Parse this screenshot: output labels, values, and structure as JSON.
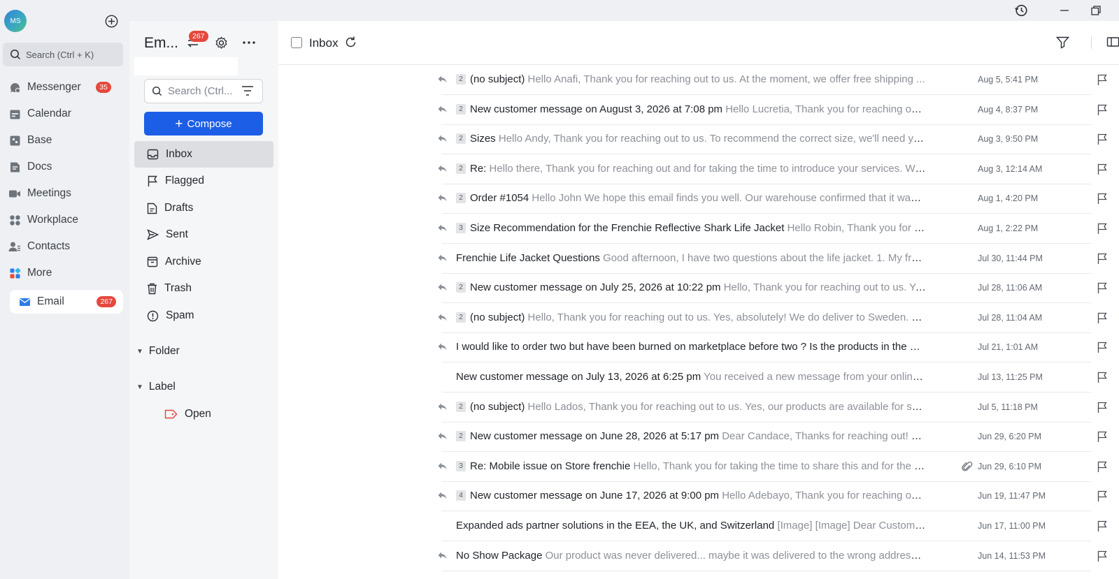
{
  "app": {
    "avatar_initials": "MS",
    "accent": "#1d5ee6",
    "badge_color": "#e5483d"
  },
  "nav": {
    "search_placeholder": "Search (Ctrl + K)",
    "items": [
      {
        "label": "Messenger",
        "icon": "messenger-icon",
        "badge": "35"
      },
      {
        "label": "Calendar",
        "icon": "calendar-icon"
      },
      {
        "label": "Base",
        "icon": "base-icon"
      },
      {
        "label": "Docs",
        "icon": "docs-icon"
      },
      {
        "label": "Meetings",
        "icon": "video-icon"
      },
      {
        "label": "Workplace",
        "icon": "grid-icon"
      },
      {
        "label": "Contacts",
        "icon": "contacts-icon"
      },
      {
        "label": "More",
        "icon": "apps-icon"
      },
      {
        "label": "Email",
        "icon": "mail-icon",
        "badge": "267"
      }
    ]
  },
  "folder_panel": {
    "title": "Em...",
    "badge": "267",
    "search_placeholder": "Search (Ctrl...",
    "compose_label": "Compose",
    "folders": [
      {
        "label": "Inbox",
        "icon": "inbox-icon"
      },
      {
        "label": "Flagged",
        "icon": "flag-icon"
      },
      {
        "label": "Drafts",
        "icon": "draft-icon"
      },
      {
        "label": "Sent",
        "icon": "send-icon"
      },
      {
        "label": "Archive",
        "icon": "archive-icon"
      },
      {
        "label": "Trash",
        "icon": "trash-icon"
      },
      {
        "label": "Spam",
        "icon": "spam-icon"
      }
    ],
    "folder_section": "Folder",
    "label_section": "Label",
    "labels": [
      {
        "label": "Open",
        "icon": "tag-icon"
      }
    ]
  },
  "mail_list": {
    "title": "Inbox",
    "rows": [
      {
        "count": "2",
        "subject": "(no subject)",
        "preview": "Hello Anafi, Thank you for reaching out to us. At the moment, we offer free shipping ...",
        "date": "Aug 5, 5:41 PM",
        "replied": true
      },
      {
        "count": "2",
        "subject": "New customer message on August 3, 2026 at 7:08 pm",
        "preview": "Hello Lucretia, Thank you for reaching out. ...",
        "date": "Aug 4, 8:37 PM",
        "replied": true
      },
      {
        "count": "2",
        "subject": "Sizes",
        "preview": "Hello Andy, Thank you for reaching out to us. To recommend the correct size, we'll need your...",
        "date": "Aug 3, 9:50 PM",
        "replied": true
      },
      {
        "count": "2",
        "subject": "Re:",
        "preview": "Hello there, Thank you for reaching out and for taking the time to introduce your services. We ...",
        "date": "Aug 3, 12:14 AM",
        "replied": true
      },
      {
        "count": "2",
        "subject": "Order #1054",
        "preview": "Hello John We hope this email finds you well. Our warehouse confirmed that it was s...",
        "date": "Aug 1, 4:20 PM",
        "replied": true
      },
      {
        "count": "3",
        "subject": "Size Recommendation for the Frenchie Reflective Shark Life Jacket",
        "preview": "Hello Robin, Thank you for reac...",
        "date": "Aug 1, 2:22 PM",
        "replied": true
      },
      {
        "count": "",
        "subject": "Frenchie Life Jacket Questions",
        "preview": "Good afternoon, I have two questions about the life jacket. 1. My frenc...",
        "date": "Jul 30, 11:44 PM",
        "replied": true
      },
      {
        "count": "2",
        "subject": "New customer message on July 25, 2026 at 10:22 pm",
        "preview": "Hello, Thank you for reaching out to us. Yes...",
        "date": "Jul 28, 11:06 AM",
        "replied": true
      },
      {
        "count": "2",
        "subject": "(no subject)",
        "preview": "Hello, Thank you for reaching out to us. Yes, absolutely! We do deliver to Sweden. On...",
        "date": "Jul 28, 11:04 AM",
        "replied": true
      },
      {
        "count": "",
        "subject": "I would like to order two but have been burned on marketplace before two ? Is the products in the U...",
        "preview": "",
        "date": "Jul 21, 1:01 AM",
        "replied": true
      },
      {
        "count": "",
        "subject": "New customer message on July 13, 2026 at 6:25 pm",
        "preview": "You received a new message from your online st...",
        "date": "Jul 13, 11:25 PM",
        "replied": false
      },
      {
        "count": "2",
        "subject": "(no subject)",
        "preview": "Hello Lados, Thank you for reaching out to us. Yes, our products are available for ship...",
        "date": "Jul 5, 11:18 PM",
        "replied": true
      },
      {
        "count": "2",
        "subject": "New customer message on June 28, 2026 at 5:17 pm",
        "preview": "Dear Candace, Thanks for reaching out! Wo...",
        "date": "Jun 29, 6:20 PM",
        "replied": true
      },
      {
        "count": "3",
        "subject": "Re: Mobile issue on Store frenchie",
        "preview": "Hello, Thank you for taking the time to share this and for the de...",
        "date": "Jun 29, 6:10 PM",
        "replied": true,
        "attachment": true
      },
      {
        "count": "4",
        "subject": "New customer message on June 17, 2026 at 9:00 pm",
        "preview": "Hello Adebayo, Thank you for reaching out a...",
        "date": "Jun 19, 11:47 PM",
        "replied": true
      },
      {
        "count": "",
        "subject": "Expanded ads partner solutions in the EEA, the UK, and Switzerland",
        "preview": "[Image] [Image] Dear Customer, ...",
        "date": "Jun 17, 11:00 PM",
        "replied": false
      },
      {
        "count": "",
        "subject": "No Show Package",
        "preview": "Our product was never delivered... maybe it was delivered to the wrong address or ...",
        "date": "Jun 14, 11:53 PM",
        "replied": true
      }
    ]
  }
}
